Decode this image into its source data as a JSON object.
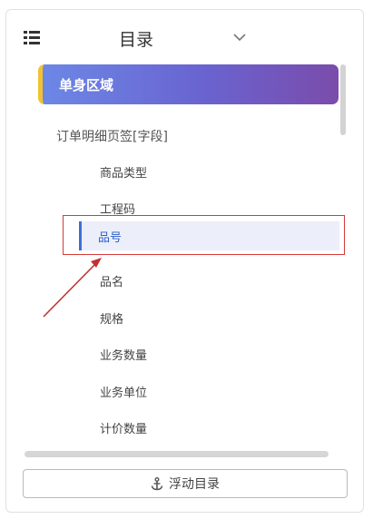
{
  "header": {
    "title": "目录",
    "list_icon": "list-icon",
    "toggle_icon": "chevron-down-icon"
  },
  "tree": {
    "region_label": "单身区域",
    "group_label": "订单明细页签[字段]",
    "items": [
      {
        "label": "商品类型"
      },
      {
        "label": "工程码"
      },
      {
        "label": "品号"
      },
      {
        "label": "品名"
      },
      {
        "label": "规格"
      },
      {
        "label": "业务数量"
      },
      {
        "label": "业务单位"
      },
      {
        "label": "计价数量"
      }
    ],
    "selected_index": 2
  },
  "footer": {
    "float_button_label": "浮动目录",
    "anchor_icon": "anchor-icon"
  },
  "colors": {
    "accent": "#3b6fd6",
    "highlight": "#d43a3a",
    "region_bar": "#f1c232"
  }
}
